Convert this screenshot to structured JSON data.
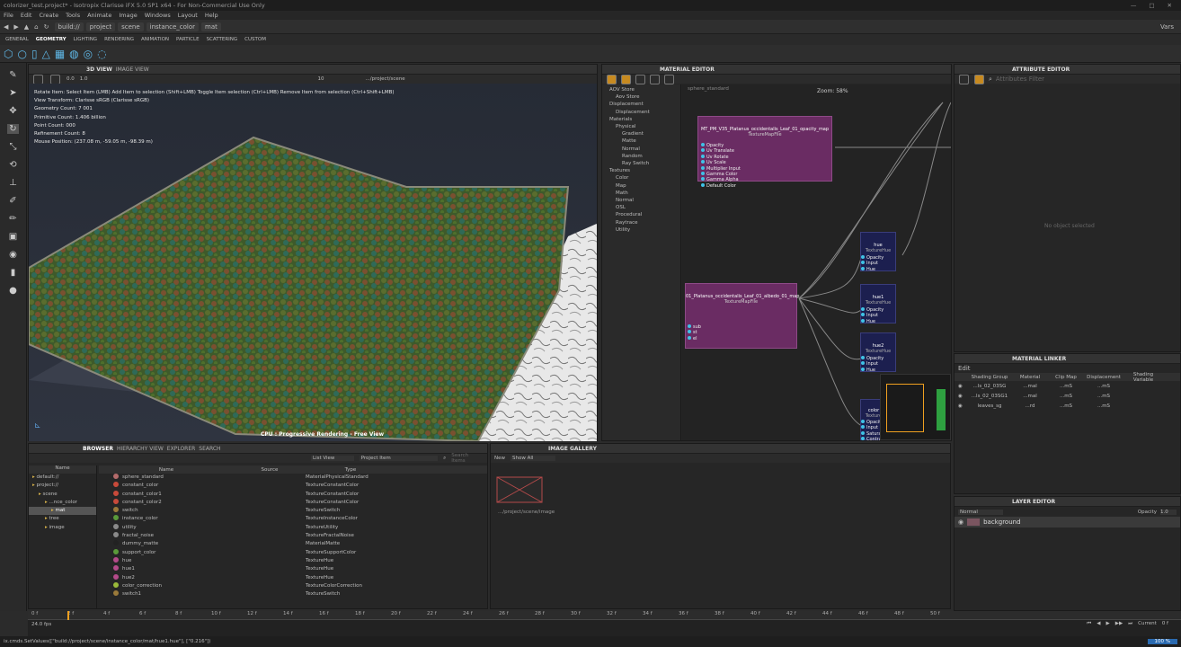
{
  "title": "colorizer_test.project* - Isotropix Clarisse iFX 5.0 SP1 x64 - For Non-Commercial Use Only",
  "menu": [
    "File",
    "Edit",
    "Create",
    "Tools",
    "Animate",
    "Image",
    "Windows",
    "Layout",
    "Help"
  ],
  "breadcrumb": [
    "build://",
    "project",
    "scene",
    "instance_color",
    "mat"
  ],
  "layout_name": "Vars",
  "shelf_tabs": [
    "GENERAL",
    "GEOMETRY",
    "LIGHTING",
    "RENDERING",
    "ANIMATION",
    "PARTICLE",
    "SCATTERING",
    "CUSTOM"
  ],
  "viewport": {
    "tabs": [
      "3D VIEW",
      "IMAGE VIEW"
    ],
    "info": [
      "Rotate Item: Select Item (LMB) Add Item to selection (Shift+LMB) Toggle Item selection (Ctrl+LMB) Remove Item from selection (Ctrl+Shift+LMB)",
      "View Transform: Clarisse sRGB (Clarisse sRGB)",
      "Geometry Count: 7 001",
      "Primitive Count: 1.406 billion",
      "Point Count: 000",
      "Refinement Count: 8",
      "Mouse Position: (237.08 m, -59.05 m, -98.39 m)"
    ],
    "status": "CPU : Progressive Rendering - Free View",
    "path": ".../project/scene",
    "value1": "0.0",
    "value2": "1.0",
    "value3": "10"
  },
  "material_editor": {
    "title": "MATERIAL EDITOR",
    "zoom": "Zoom: 58%",
    "graph_label": "sphere_standard",
    "library": [
      {
        "t": "AOV Store",
        "d": 0
      },
      {
        "t": "Aov Store",
        "d": 1
      },
      {
        "t": "Displacement",
        "d": 0
      },
      {
        "t": "Displacement",
        "d": 1
      },
      {
        "t": "Materials",
        "d": 0
      },
      {
        "t": "Physical",
        "d": 1
      },
      {
        "t": "Gradient",
        "d": 2
      },
      {
        "t": "Matte",
        "d": 2
      },
      {
        "t": "Normal",
        "d": 2
      },
      {
        "t": "Random",
        "d": 2
      },
      {
        "t": "Ray Switch",
        "d": 2
      },
      {
        "t": "Textures",
        "d": 0
      },
      {
        "t": "Color",
        "d": 1
      },
      {
        "t": "Map",
        "d": 1
      },
      {
        "t": "Math",
        "d": 1
      },
      {
        "t": "Normal",
        "d": 1
      },
      {
        "t": "OSL",
        "d": 1
      },
      {
        "t": "Procedural",
        "d": 1
      },
      {
        "t": "Raytrace",
        "d": 1
      },
      {
        "t": "Utility",
        "d": 1
      }
    ],
    "nodes": {
      "n1": {
        "title": "MT_PM_V35_Platanus_occidentalis_Leaf_01_opacity_map",
        "sub": "TextureMapFile",
        "ports": [
          "Opacity",
          "Uv Translate",
          "Uv Rotate",
          "Uv Scale",
          "Multiplier Input",
          "Gamma Color",
          "Gamma Alpha",
          "Default Color"
        ]
      },
      "n2": {
        "title": "01_Platanus_occidentalis_Leaf_01_albedo_01_map",
        "sub": "TextureMapFile",
        "ports": [
          "sub",
          "st",
          "el"
        ]
      },
      "hue": {
        "title": "hue",
        "sub": "TextureHue",
        "ports": [
          "Opacity",
          "Input",
          "Hue"
        ]
      },
      "hue1": {
        "title": "hue1",
        "sub": "TextureHue",
        "ports": [
          "Opacity",
          "Input",
          "Hue"
        ]
      },
      "hue2": {
        "title": "hue2",
        "sub": "TextureHue",
        "ports": [
          "Opacity",
          "Input",
          "Hue"
        ]
      },
      "color": {
        "title": "color",
        "sub": "Texture",
        "ports": [
          "Opacity",
          "Input",
          "Saturatio",
          "Contrast"
        ]
      }
    }
  },
  "attribute_editor": {
    "title": "ATTRIBUTE EDITOR",
    "filter": "Attributes Filter",
    "empty": "No object selected"
  },
  "material_linker": {
    "title": "MATERIAL LINKER",
    "edit": "Edit",
    "columns": [
      "Shading Group",
      "Material",
      "Clip Map",
      "Displacement",
      "Shading Variable"
    ],
    "rows": [
      {
        "g": "...ls_02_03SG",
        "m": "...mal",
        "c": "...mS",
        "d": "...mS"
      },
      {
        "g": "...ls_02_03SG1",
        "m": "...mal",
        "c": "...mS",
        "d": "...mS"
      },
      {
        "g": "leaves_sg",
        "m": "...rd",
        "c": "...mS",
        "d": "...mS"
      }
    ]
  },
  "layer_editor": {
    "title": "LAYER EDITOR",
    "blend": "Normal",
    "opacity_label": "Opacity",
    "opacity": "1.0",
    "layer": "background"
  },
  "browser": {
    "tabs": [
      "BROWSER",
      "HIERARCHY VIEW",
      "EXPLORER",
      "SEARCH"
    ],
    "view": "List View",
    "scope": "Project Item",
    "search": "Search Items",
    "tree_header": "Name",
    "tree": [
      {
        "t": "default://",
        "d": 0
      },
      {
        "t": "project://",
        "d": 0
      },
      {
        "t": "scene",
        "d": 1
      },
      {
        "t": "...nce_color",
        "d": 2
      },
      {
        "t": "mat",
        "d": 3
      },
      {
        "t": "tree",
        "d": 2
      },
      {
        "t": "image",
        "d": 2
      }
    ],
    "columns": [
      "Name",
      "Source",
      "Type"
    ],
    "items": [
      {
        "n": "sphere_standard",
        "t": "MaterialPhysicalStandard",
        "c": "#b46b6b"
      },
      {
        "n": "constant_color",
        "t": "TextureConstantColor",
        "c": "#c84a3a"
      },
      {
        "n": "constant_color1",
        "t": "TextureConstantColor",
        "c": "#c84a3a"
      },
      {
        "n": "constant_color2",
        "t": "TextureConstantColor",
        "c": "#c84a3a"
      },
      {
        "n": "switch",
        "t": "TextureSwitch",
        "c": "#9a7a3a"
      },
      {
        "n": "instance_color",
        "t": "TextureInstanceColor",
        "c": "#5a9a3a"
      },
      {
        "n": "utility",
        "t": "TextureUtility",
        "c": "#8a8a8a"
      },
      {
        "n": "fractal_noise",
        "t": "TextureFractalNoise",
        "c": "#8a8a8a"
      },
      {
        "n": "dummy_matte",
        "t": "MaterialMatte",
        "c": "#222222"
      },
      {
        "n": "support_color",
        "t": "TextureSupportColor",
        "c": "#5a9a3a"
      },
      {
        "n": "hue",
        "t": "TextureHue",
        "c": "#b44a8a"
      },
      {
        "n": "hue1",
        "t": "TextureHue",
        "c": "#b44a8a"
      },
      {
        "n": "hue2",
        "t": "TextureHue",
        "c": "#b44a8a"
      },
      {
        "n": "color_correction",
        "t": "TextureColorCorrection",
        "c": "#9aba3a"
      },
      {
        "n": "switch1",
        "t": "TextureSwitch",
        "c": "#9a7a3a"
      }
    ]
  },
  "gallery": {
    "title": "IMAGE GALLERY",
    "new": "New",
    "show": "Show All",
    "thumb": ".../project/scene/image"
  },
  "timeline": {
    "ticks": [
      "0 f",
      "2 f",
      "4 f",
      "6 f",
      "8 f",
      "10 f",
      "12 f",
      "14 f",
      "16 f",
      "18 f",
      "20 f",
      "22 f",
      "24 f",
      "26 f",
      "28 f",
      "30 f",
      "32 f",
      "34 f",
      "36 f",
      "38 f",
      "40 f",
      "42 f",
      "44 f",
      "46 f",
      "48 f",
      "50 f"
    ],
    "start": "0 f",
    "end": "50 f",
    "fps": "24.0 fps",
    "current_label": "Current",
    "current": "0 f"
  },
  "statusbar": {
    "cmd": "ix.cmds.SetValues([\"build://project/scene/instance_color/mat/hue1.hue\"], [\"0.216\"])",
    "zoom": "100 %"
  },
  "colors": {
    "node": "#6a2c63",
    "accent": "#f0a020"
  }
}
